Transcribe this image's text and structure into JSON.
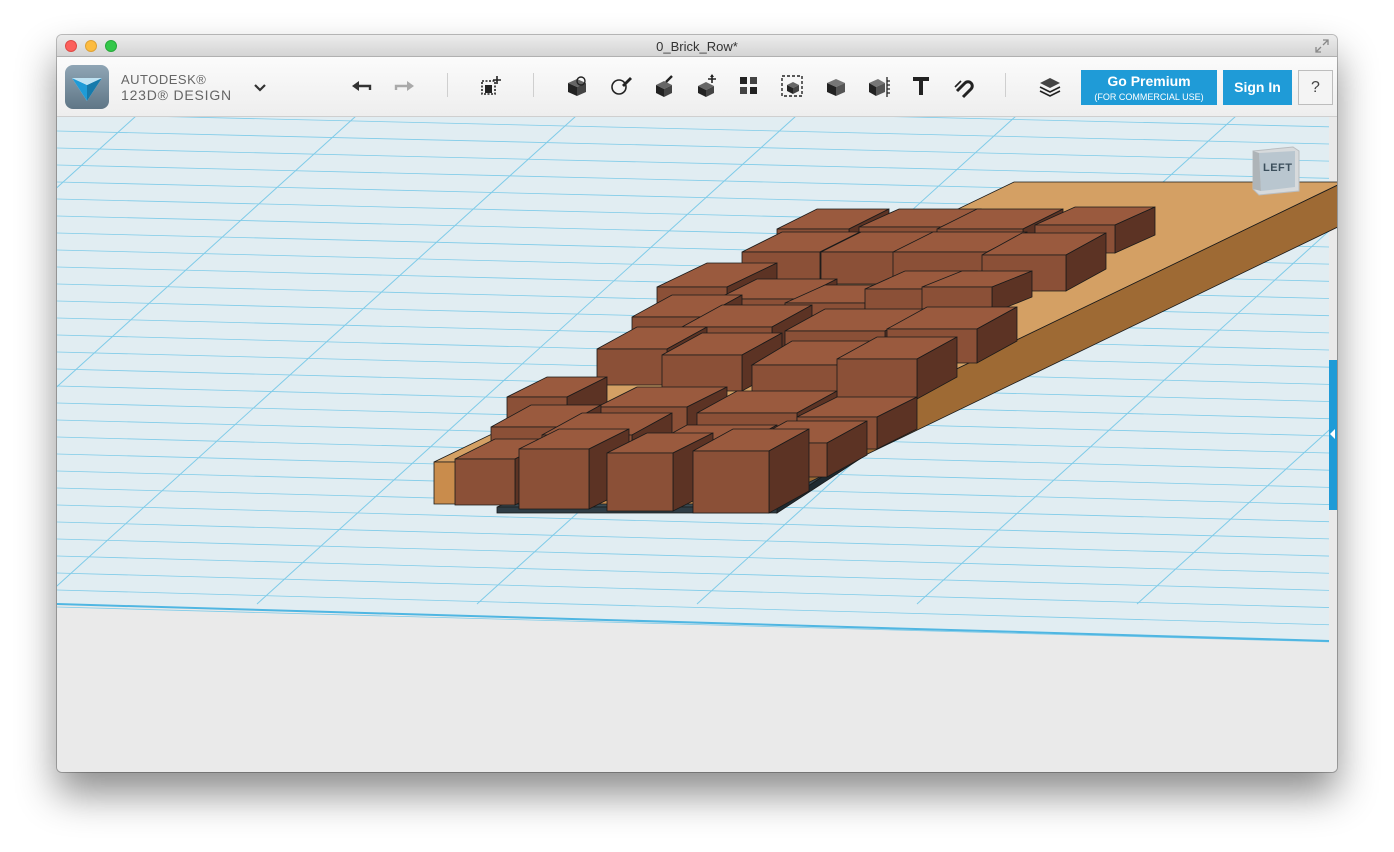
{
  "window": {
    "title": "0_Brick_Row*"
  },
  "brand": {
    "company": "AUTODESK®",
    "product": "123D® DESIGN"
  },
  "toolbar": {
    "tools": [
      {
        "name": "undo",
        "icon": "undo-arrow-icon"
      },
      {
        "name": "redo",
        "icon": "redo-arrow-icon"
      },
      {
        "name": "transform",
        "icon": "move-cube-icon"
      },
      {
        "name": "primitives",
        "icon": "primitive-box-icon"
      },
      {
        "name": "sketch",
        "icon": "sketch-pencil-icon"
      },
      {
        "name": "construct",
        "icon": "construct-extrude-icon"
      },
      {
        "name": "modify",
        "icon": "modify-cube-icon"
      },
      {
        "name": "pattern",
        "icon": "pattern-grid-icon"
      },
      {
        "name": "grouping",
        "icon": "group-icon"
      },
      {
        "name": "combine",
        "icon": "combine-solid-icon"
      },
      {
        "name": "measure",
        "icon": "measure-ruler-icon"
      },
      {
        "name": "text",
        "icon": "text-t-icon"
      },
      {
        "name": "snap",
        "icon": "snap-magnet-icon"
      },
      {
        "name": "materials",
        "icon": "layers-stack-icon"
      }
    ],
    "premium": {
      "title": "Go Premium",
      "subtitle": "(FOR COMMERCIAL USE)"
    },
    "signin": "Sign In",
    "help": "?"
  },
  "viewport": {
    "viewcube_label": "LEFT"
  },
  "colors": {
    "accent": "#1f9bd7",
    "grid_line": "#7fcbe8",
    "brick": "#8b5037",
    "wood": "#c98c4c",
    "base_dark": "#2f3d45"
  }
}
